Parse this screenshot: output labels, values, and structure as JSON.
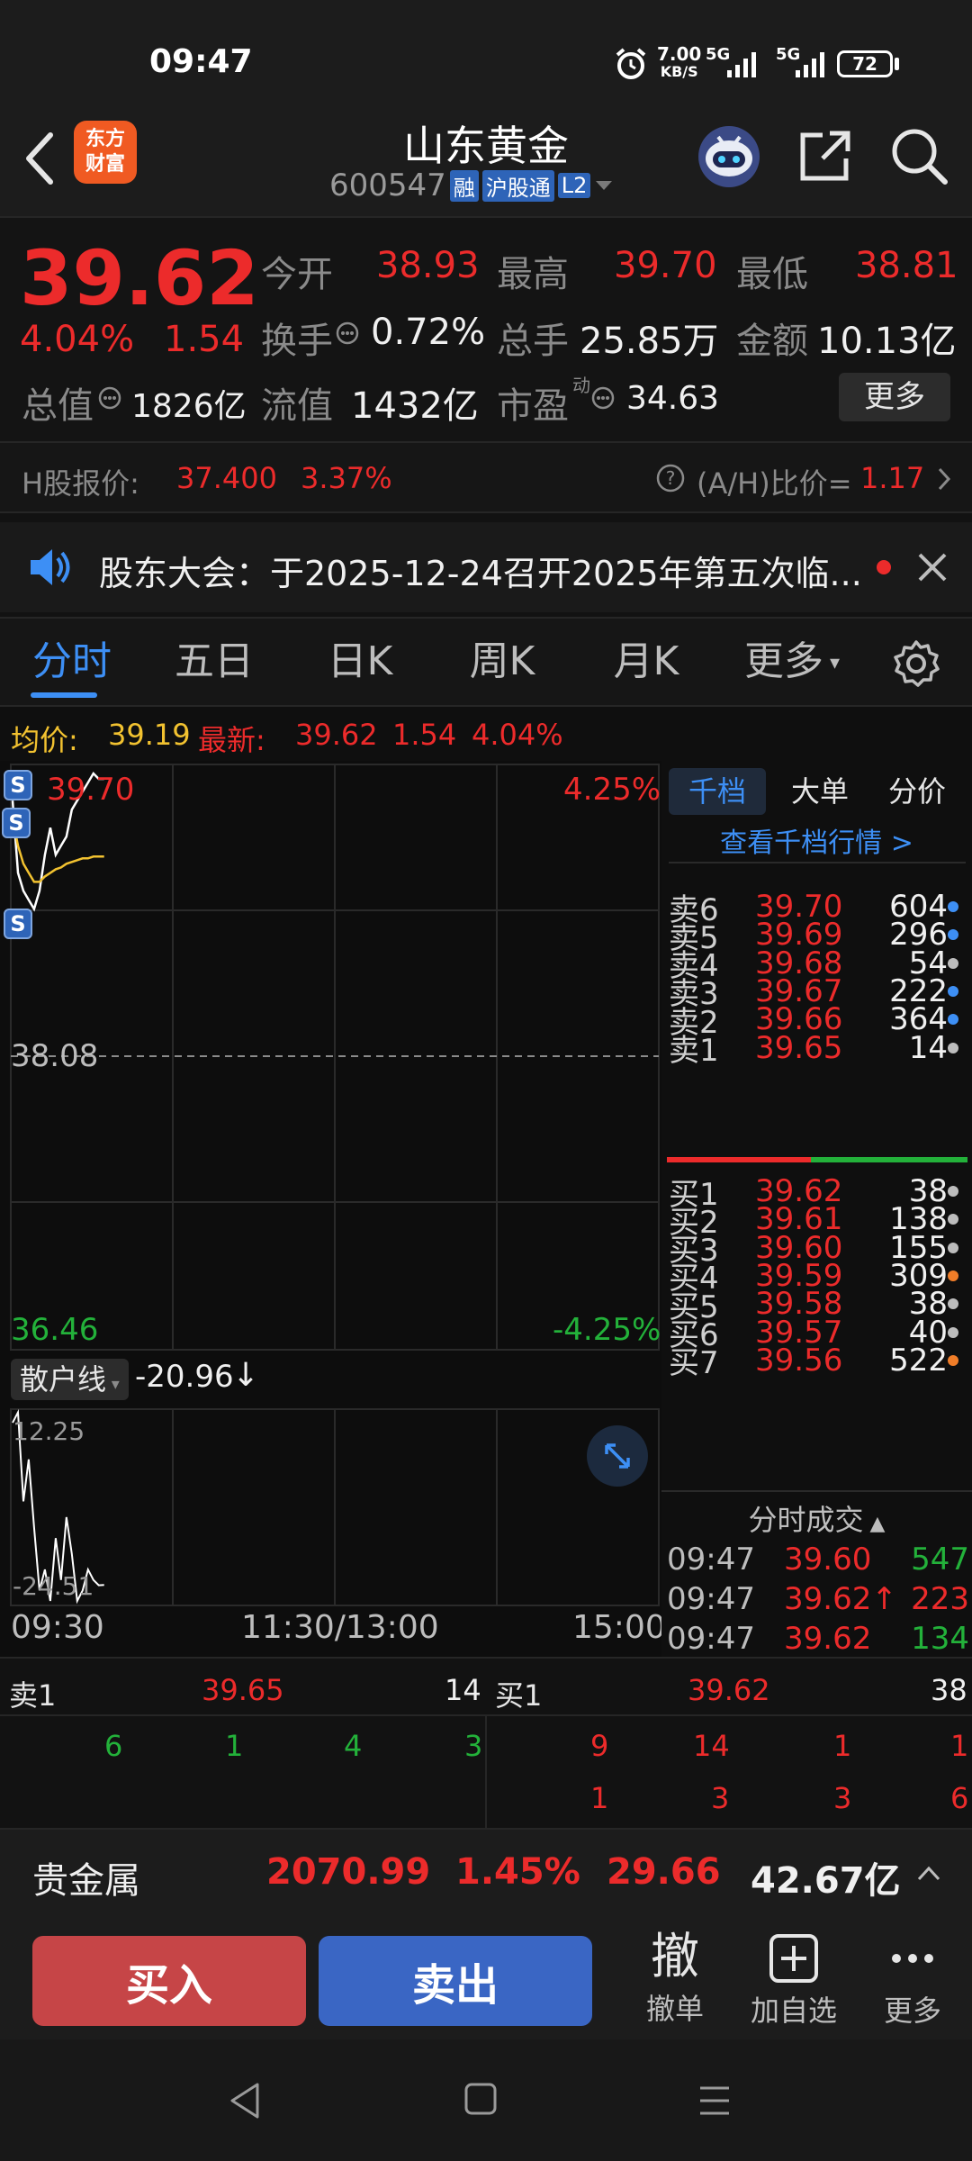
{
  "status_bar": {
    "time": "09:47",
    "net_speed_top": "7.00",
    "net_speed_unit": "KB/S",
    "signal1": "5G",
    "signal2": "5G",
    "battery": "72"
  },
  "header": {
    "stock_name": "山东黄金",
    "stock_code": "600547",
    "badges": [
      "融",
      "沪股通",
      "L2"
    ],
    "brand_logo": "东方\n财富"
  },
  "quote": {
    "price": "39.62",
    "change_pct": "4.04%",
    "change": "1.54",
    "open_label": "今开",
    "open": "38.93",
    "high_label": "最高",
    "high": "39.70",
    "low_label": "最低",
    "low": "38.81",
    "turnover_label": "换手",
    "turnover": "0.72%",
    "volume_label": "总手",
    "volume": "25.85万",
    "amount_label": "金额",
    "amount": "10.13亿",
    "mktcap_label": "总值",
    "mktcap": "1826亿",
    "float_label": "流值",
    "float": "1432亿",
    "pe_label": "市盈",
    "pe_sup": "动",
    "pe": "34.63",
    "more_button": "更多"
  },
  "h_share": {
    "label": "H股报价:",
    "price": "37.400",
    "pct": "3.37%",
    "ah_label": "(A/H)比价=",
    "ah_value": "1.17"
  },
  "notice": {
    "text": "股东大会：于2025-12-24召开2025年第五次临..."
  },
  "tabs": [
    "分时",
    "五日",
    "日K",
    "周K",
    "月K",
    "更多"
  ],
  "avg_line": {
    "avg_label": "均价:",
    "avg": "39.19",
    "latest_label": "最新:",
    "latest": "39.62",
    "change": "1.54",
    "pct": "4.04%"
  },
  "chart": {
    "top_price": "39.70",
    "top_pct": "4.25%",
    "mid_price": "38.08",
    "bottom_price": "36.46",
    "bottom_pct": "-4.25%",
    "sub_indicator": "散户线",
    "sub_value": "-20.96",
    "sub_arrow": "↓",
    "sub_top": "12.25",
    "sub_bottom": "-24.51",
    "x_labels": [
      "09:30",
      "11:30/13:00",
      "15:00"
    ],
    "s_badge": "S"
  },
  "chart_data": {
    "type": "line",
    "x": [
      "09:30",
      "09:31",
      "09:32",
      "09:33",
      "09:34",
      "09:35",
      "09:36",
      "09:37",
      "09:38",
      "09:39",
      "09:40",
      "09:41",
      "09:42",
      "09:43",
      "09:44",
      "09:45",
      "09:46",
      "09:47"
    ],
    "series": [
      {
        "values": [
          39.5,
          39.1,
          39.0,
          38.95,
          38.9,
          39.0,
          39.2,
          39.35,
          39.2,
          39.25,
          39.3,
          39.45,
          39.5,
          39.55,
          39.6,
          39.65,
          39.62,
          39.62
        ]
      },
      {
        "values": [
          39.4,
          39.25,
          39.15,
          39.1,
          39.05,
          39.05,
          39.08,
          39.1,
          39.12,
          39.13,
          39.15,
          39.16,
          39.17,
          39.18,
          39.18,
          39.19,
          39.19,
          39.19
        ]
      }
    ],
    "ylim": [
      36.46,
      39.7
    ],
    "sub_series": [
      10,
      12,
      -5,
      3,
      -10,
      -22,
      -18,
      -24,
      -12,
      -20,
      -8,
      -15,
      -24,
      -22,
      -18,
      -20,
      -21,
      -20.96
    ],
    "sub_ylim": [
      -24.51,
      12.25
    ]
  },
  "depth": {
    "tabs": [
      "千档",
      "大单",
      "分价"
    ],
    "link": "查看千档行情 >",
    "asks": [
      {
        "label": "卖6",
        "price": "39.70",
        "vol": "604",
        "dot": "#3d8ff5"
      },
      {
        "label": "卖5",
        "price": "39.69",
        "vol": "296",
        "dot": "#3d8ff5"
      },
      {
        "label": "卖4",
        "price": "39.68",
        "vol": "54",
        "dot": "#bdbdbd"
      },
      {
        "label": "卖3",
        "price": "39.67",
        "vol": "222",
        "dot": "#3d8ff5"
      },
      {
        "label": "卖2",
        "price": "39.66",
        "vol": "364",
        "dot": "#3d8ff5"
      },
      {
        "label": "卖1",
        "price": "39.65",
        "vol": "14",
        "dot": "#bdbdbd"
      }
    ],
    "bids": [
      {
        "label": "买1",
        "price": "39.62",
        "vol": "38",
        "dot": "#bdbdbd"
      },
      {
        "label": "买2",
        "price": "39.61",
        "vol": "138",
        "dot": "#bdbdbd"
      },
      {
        "label": "买3",
        "price": "39.60",
        "vol": "155",
        "dot": "#bdbdbd"
      },
      {
        "label": "买4",
        "price": "39.59",
        "vol": "309",
        "dot": "#f07d28"
      },
      {
        "label": "买5",
        "price": "39.58",
        "vol": "38",
        "dot": "#bdbdbd"
      },
      {
        "label": "买6",
        "price": "39.57",
        "vol": "40",
        "dot": "#bdbdbd"
      },
      {
        "label": "买7",
        "price": "39.56",
        "vol": "522",
        "dot": "#f07d28"
      }
    ],
    "trades_title": "分时成交",
    "trades": [
      {
        "time": "09:47",
        "price": "39.60",
        "arrow": "",
        "vol": "547",
        "color": "#23b13a"
      },
      {
        "time": "09:47",
        "price": "39.62",
        "arrow": "↑",
        "vol": "223",
        "color": "#ec2b2b"
      },
      {
        "time": "09:47",
        "price": "39.62",
        "arrow": "",
        "vol": "134",
        "color": "#23b13a"
      }
    ]
  },
  "level1": {
    "sell_label": "卖1",
    "sell_price": "39.65",
    "sell_vol": "14",
    "buy_label": "买1",
    "buy_price": "39.62",
    "buy_vol": "38",
    "sell_queue": [
      "6",
      "1",
      "4",
      "3"
    ],
    "buy_queue_row1": [
      "9",
      "14",
      "1",
      "1"
    ],
    "buy_queue_row2": [
      "1",
      "3",
      "3",
      "6"
    ]
  },
  "sector": {
    "name": "贵金属",
    "index": "2070.99",
    "pct": "1.45%",
    "change": "29.66",
    "amount": "42.67亿"
  },
  "actions": {
    "buy": "买入",
    "sell": "卖出",
    "cancel_glyph": "撤",
    "cancel": "撤单",
    "add_watch": "加自选",
    "more": "更多"
  }
}
